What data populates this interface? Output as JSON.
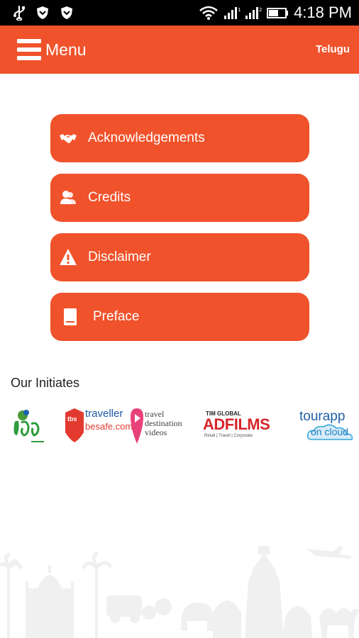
{
  "status_bar": {
    "time": "4:18 PM",
    "icons": [
      "usb-icon",
      "shield-icon",
      "shield-icon",
      "wifi-icon",
      "signal-icon",
      "signal-icon",
      "battery-icon"
    ]
  },
  "app_bar": {
    "menu_label": "Menu",
    "language_label": "Telugu",
    "accent_color": "#f0522b"
  },
  "menu_items": [
    {
      "label": "Acknowledgements",
      "icon": "handshake-icon"
    },
    {
      "label": "Credits",
      "icon": "users-icon"
    },
    {
      "label": "Disclaimer",
      "icon": "warning-icon"
    },
    {
      "label": "Preface",
      "icon": "document-icon"
    }
  ],
  "initiates": {
    "title": "Our Initiates",
    "logos": [
      {
        "name": "vihara-logo"
      },
      {
        "name": "tbs-logo",
        "text_lines": [
          "traveller",
          "besafe.com"
        ],
        "badge": "tbs"
      },
      {
        "name": "tdv-logo",
        "text_lines": [
          "travel",
          "destination",
          "videos"
        ]
      },
      {
        "name": "tim-adfilms-logo",
        "text_lines": [
          "TIM GLOBAL",
          "ADFILMS",
          "Retail | Travel | Corporate"
        ]
      },
      {
        "name": "tourapp-logo",
        "text_lines": [
          "tourapp",
          "on cloud"
        ]
      }
    ]
  }
}
